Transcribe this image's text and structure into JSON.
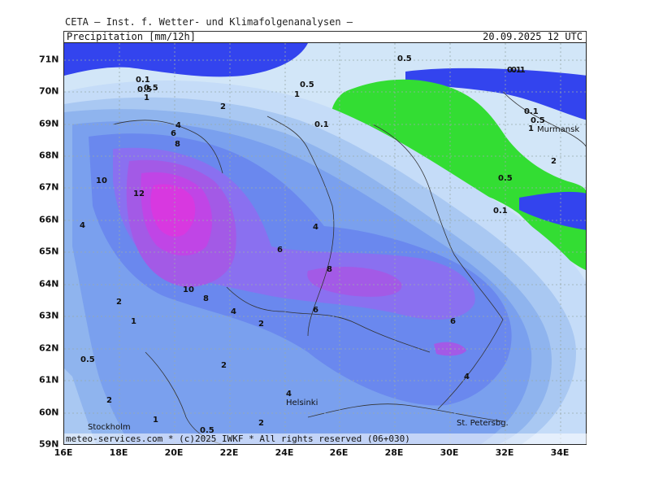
{
  "header": {
    "source": "CETA — Inst. f. Wetter- und Klimafolgenanalysen —",
    "product": "Precipitation [mm/12h]",
    "timestamp": "20.09.2025 12 UTC"
  },
  "footer": {
    "credit": "meteo-services.com * (c)2025 IWKF * All rights reserved (06+030)"
  },
  "axes": {
    "lat_labels": [
      "71N",
      "70N",
      "69N",
      "68N",
      "67N",
      "66N",
      "65N",
      "64N",
      "63N",
      "62N",
      "61N",
      "60N",
      "59N"
    ],
    "lon_labels": [
      "16E",
      "18E",
      "20E",
      "22E",
      "24E",
      "26E",
      "28E",
      "30E",
      "32E",
      "34E"
    ]
  },
  "cities": {
    "murmansk": "Murmansk",
    "stockholm": "Stockholm",
    "helsinki": "Helsinki",
    "st_petersburg": "St. Petersbg."
  },
  "contour_labels": {
    "l01": "0.5",
    "l02": "0.1",
    "l03": "0.1",
    "l04": "0.5",
    "l05": "0.5",
    "l06": "1",
    "l07": "1",
    "l08": "2",
    "l09": "0.1",
    "l10": "4",
    "l11": "6",
    "l12": "8",
    "l13": "10",
    "l14": "12",
    "l15": "4",
    "l16": "4",
    "l17": "6",
    "l18": "8",
    "l19": "10",
    "l20": "8",
    "l21": "4",
    "l22": "6",
    "l23": "2",
    "l24": "2",
    "l25": "1",
    "l26": "6",
    "l27": "0.5",
    "l28": "2",
    "l29": "4",
    "l30": "2",
    "l31": "1",
    "l32": "0.5",
    "l33": "2",
    "l34": "4",
    "l35": "0.1",
    "l36": "0.5",
    "l37": "1",
    "l38": "2",
    "l39": "0.5",
    "l40": "0.1",
    "l41": "0.1",
    "l42": "0.5"
  },
  "legend_colors": {
    "sea": "#d2e6f8",
    "dry": "#33dd33",
    "c0_1": "#c5dcf8",
    "c0_5": "#a9c8f2",
    "c1": "#8fb4ee",
    "c2": "#7aa0ee",
    "c4": "#6a88ee",
    "c6": "#8a70f0",
    "c8": "#a35ae6",
    "c10": "#c045e6",
    "c12": "#d838e0",
    "snow_sea": "#3344ee"
  }
}
